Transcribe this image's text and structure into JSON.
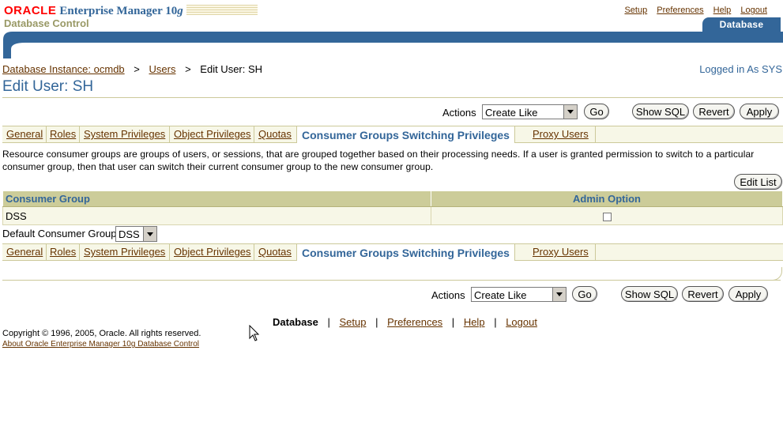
{
  "brand": {
    "oracle": "ORACLE",
    "product_prefix": "Enterprise Manager 10",
    "product_version_suffix": "g",
    "product_sub": "Database Control"
  },
  "global_links": [
    "Setup",
    "Preferences",
    "Help",
    "Logout"
  ],
  "main_tab": "Database",
  "breadcrumb": {
    "items": [
      "Database Instance: ocmdb",
      "Users"
    ],
    "separator": ">",
    "current": "Edit User: SH"
  },
  "logged_in": "Logged in As SYS",
  "page_title": "Edit User: SH",
  "actions": {
    "label": "Actions",
    "selected": "Create Like",
    "go": "Go",
    "show_sql": "Show SQL",
    "revert": "Revert",
    "apply": "Apply"
  },
  "subtabs": {
    "items": [
      "General",
      "Roles",
      "System Privileges",
      "Object Privileges",
      "Quotas",
      "Consumer Groups Switching Privileges",
      "Proxy Users"
    ],
    "active": "Consumer Groups Switching Privileges"
  },
  "description": "Resource consumer groups are groups of users, or sessions, that are grouped together based on their processing needs. If a user is granted permission to switch to a particular consumer group, then that user can switch their current consumer group to the new consumer group.",
  "edit_list": "Edit List",
  "table": {
    "columns": [
      "Consumer Group",
      "Admin Option"
    ],
    "rows": [
      {
        "consumer_group": "DSS",
        "admin_option": false
      }
    ]
  },
  "default_consumer_group": {
    "label": "Default Consumer Group",
    "value": "DSS"
  },
  "footer": {
    "current": "Database",
    "links": [
      "Setup",
      "Preferences",
      "Help",
      "Logout"
    ],
    "separator": "|",
    "copyright": "Copyright © 1996, 2005, Oracle. All rights reserved.",
    "about": "About Oracle Enterprise Manager 10g Database Control"
  },
  "colors": {
    "brand_red": "#ff0000",
    "brand_blue": "#336699",
    "link_brown": "#663300",
    "header_tan": "#cccc99",
    "row_cream": "#f7f7e7"
  }
}
